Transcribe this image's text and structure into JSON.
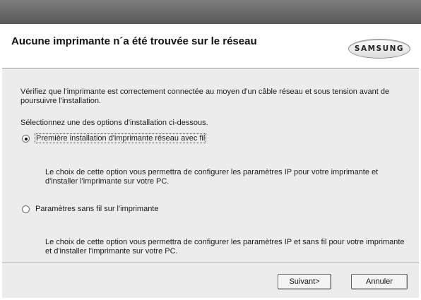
{
  "header": {
    "title": "Aucune imprimante n´a été trouvée sur le réseau",
    "logo_text": "SAMSUNG"
  },
  "body": {
    "intro": "Vérifiez que l'imprimante est correctement connectée au moyen d'un câble réseau et sous tension avant de poursuivre l'installation.",
    "select_label": "Sélectionnez une des options d'installation ci-dessous.",
    "options": [
      {
        "label": "Première installation d'imprimante réseau avec fil",
        "selected": true,
        "description": "Le choix de cette option vous permettra de configurer les paramètres IP pour votre imprimante et d'installer l'imprimante sur votre PC."
      },
      {
        "label": "Paramètres sans fil sur l'imprimante",
        "selected": false,
        "description": "Le choix de cette option vous permettra de configurer les paramètres IP et sans fil pour votre imprimante et d'installer l'imprimante sur votre PC."
      }
    ]
  },
  "footer": {
    "next_label": "Suivant>",
    "cancel_label": "Annuler"
  },
  "colors": {
    "titlebar": "#6b6b6b",
    "panel": "#ececec",
    "header": "#ffffff"
  }
}
